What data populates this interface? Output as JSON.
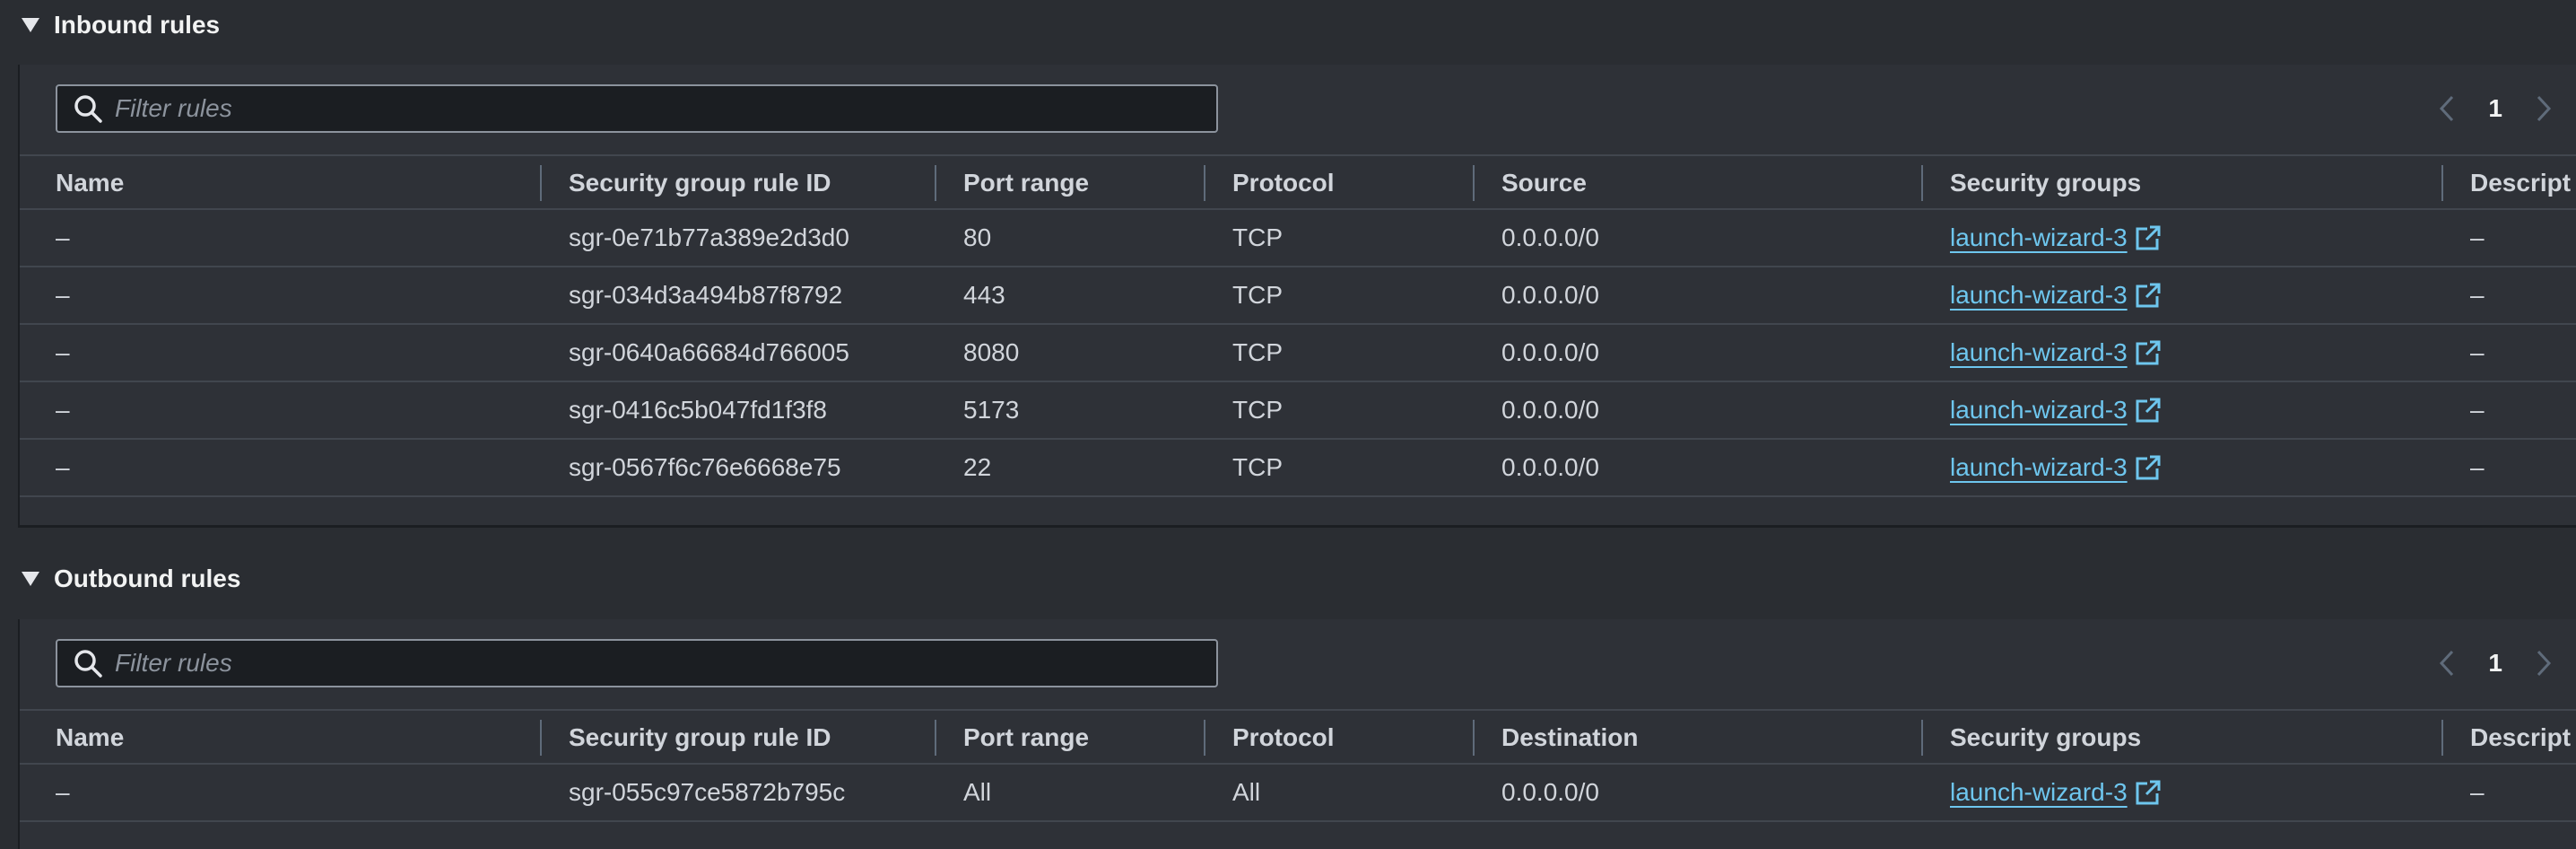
{
  "inbound": {
    "title": "Inbound rules",
    "filter_placeholder": "Filter rules",
    "page": "1",
    "columns": [
      "Name",
      "Security group rule ID",
      "Port range",
      "Protocol",
      "Source",
      "Security groups",
      "Descripti"
    ],
    "rows": [
      {
        "name": "–",
        "rule_id": "sgr-0e71b77a389e2d3d0",
        "port": "80",
        "protocol": "TCP",
        "source": "0.0.0.0/0",
        "group": "launch-wizard-3",
        "desc": "–"
      },
      {
        "name": "–",
        "rule_id": "sgr-034d3a494b87f8792",
        "port": "443",
        "protocol": "TCP",
        "source": "0.0.0.0/0",
        "group": "launch-wizard-3",
        "desc": "–"
      },
      {
        "name": "–",
        "rule_id": "sgr-0640a66684d766005",
        "port": "8080",
        "protocol": "TCP",
        "source": "0.0.0.0/0",
        "group": "launch-wizard-3",
        "desc": "–"
      },
      {
        "name": "–",
        "rule_id": "sgr-0416c5b047fd1f3f8",
        "port": "5173",
        "protocol": "TCP",
        "source": "0.0.0.0/0",
        "group": "launch-wizard-3",
        "desc": "–"
      },
      {
        "name": "–",
        "rule_id": "sgr-0567f6c76e6668e75",
        "port": "22",
        "protocol": "TCP",
        "source": "0.0.0.0/0",
        "group": "launch-wizard-3",
        "desc": "–"
      }
    ]
  },
  "outbound": {
    "title": "Outbound rules",
    "filter_placeholder": "Filter rules",
    "page": "1",
    "columns": [
      "Name",
      "Security group rule ID",
      "Port range",
      "Protocol",
      "Destination",
      "Security groups",
      "Descripti"
    ],
    "rows": [
      {
        "name": "–",
        "rule_id": "sgr-055c97ce5872b795c",
        "port": "All",
        "protocol": "All",
        "source": "0.0.0.0/0",
        "group": "launch-wizard-3",
        "desc": "–"
      }
    ]
  },
  "icons": {
    "caret": "caret-down-icon",
    "search": "search-icon",
    "prev": "chevron-left-icon",
    "next": "chevron-right-icon",
    "external": "external-link-icon"
  },
  "colors": {
    "background": "#2a2d32",
    "panel": "#2e3137",
    "link": "#6ec6ee",
    "text": "#d1d5db"
  }
}
